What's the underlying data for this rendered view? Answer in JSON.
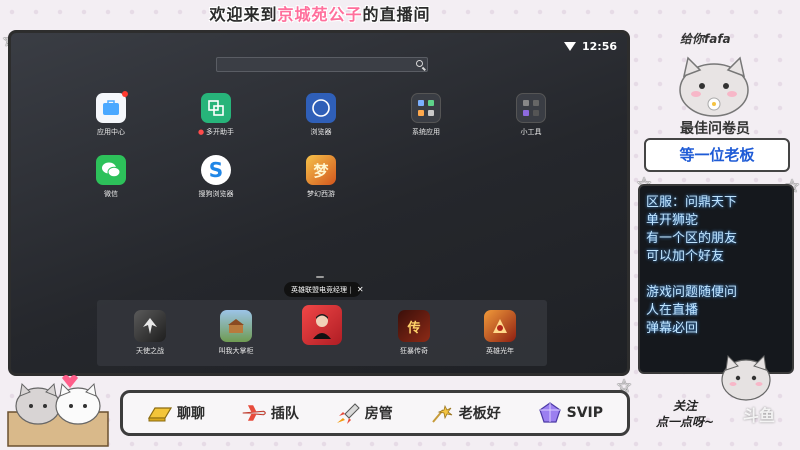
{
  "overlay": {
    "title_prefix": "欢迎来到",
    "title_name": "京城苑公子",
    "title_suffix": "的直播间",
    "gift_text": "给你fafa",
    "best_q_title": "最佳问卷员",
    "best_q_value": "等一位老板",
    "info_lines": [
      "区服：问鼎天下",
      "单开狮驼",
      "有一个区的朋友",
      "可以加个好友",
      "",
      "游戏问题随便问",
      "人在直播",
      "弹幕必回"
    ],
    "follow_text_1": "关注",
    "follow_text_2": "点一点呀~",
    "watermark": "斗鱼"
  },
  "bottom_bar": {
    "items": [
      {
        "label": "聊聊",
        "icon": "gold-bar-icon"
      },
      {
        "label": "插队",
        "icon": "plane-icon"
      },
      {
        "label": "房管",
        "icon": "rocket-icon"
      },
      {
        "label": "老板好",
        "icon": "fireworks-icon"
      },
      {
        "label": "SVIP",
        "icon": "svip-crystal-icon"
      }
    ]
  },
  "phone": {
    "time": "12:56",
    "search_placeholder": "",
    "apps": [
      {
        "label": "应用中心",
        "icon": "app-center-icon",
        "color": "#4aa8ff"
      },
      {
        "label": "多开助手",
        "icon": "multi-open-icon",
        "color": "#27b47a"
      },
      {
        "label": "浏览器",
        "icon": "browser-icon",
        "color": "#2f5fb8"
      },
      {
        "label": "系统应用",
        "icon": "system-apps-folder-icon",
        "color": "#3a3d44"
      },
      {
        "label": "小工具",
        "icon": "tools-folder-icon",
        "color": "#3a3d44"
      },
      {
        "label": "微信",
        "icon": "wechat-icon",
        "color": "#2dc15a"
      },
      {
        "label": "搜狗浏览器",
        "icon": "sogou-browser-icon",
        "color": "#ffffff"
      },
      {
        "label": "梦幻西游",
        "icon": "menghuan-xiyou-icon",
        "color": "#e8892a"
      }
    ],
    "tooltip": "英雄联盟电竞经理",
    "dock": [
      {
        "label": "天使之战",
        "icon": "angel-war-icon",
        "color": "#3b3b3b"
      },
      {
        "label": "叫我大掌柜",
        "icon": "shopkeeper-icon",
        "color": "#7fa86a"
      },
      {
        "label": "英雄联盟电竞经理",
        "icon": "lol-manager-icon",
        "color": "#d9262e"
      },
      {
        "label": "狂暴传奇",
        "icon": "rage-legend-icon",
        "color": "#6b1a12"
      },
      {
        "label": "英雄光年",
        "icon": "hero-lightyear-icon",
        "color": "#a8341c"
      }
    ]
  }
}
